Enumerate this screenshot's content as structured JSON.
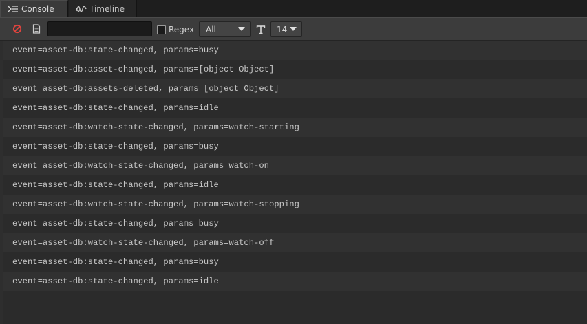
{
  "tabs": [
    {
      "label": "Console",
      "icon": "terminal-icon",
      "active": true
    },
    {
      "label": "Timeline",
      "icon": "timeline-icon",
      "active": false
    }
  ],
  "toolbar": {
    "filter_value": "",
    "regex_label": "Regex",
    "regex_checked": false,
    "level_select": "All",
    "font_size_select": "14",
    "clear_icon_color": "#e0443e"
  },
  "log_rows": [
    "event=asset-db:state-changed, params=busy",
    "event=asset-db:asset-changed, params=[object Object]",
    "event=asset-db:assets-deleted, params=[object Object]",
    "event=asset-db:state-changed, params=idle",
    "event=asset-db:watch-state-changed, params=watch-starting",
    "event=asset-db:state-changed, params=busy",
    "event=asset-db:watch-state-changed, params=watch-on",
    "event=asset-db:state-changed, params=idle",
    "event=asset-db:watch-state-changed, params=watch-stopping",
    "event=asset-db:state-changed, params=busy",
    "event=asset-db:watch-state-changed, params=watch-off",
    "event=asset-db:state-changed, params=busy",
    "event=asset-db:state-changed, params=idle"
  ]
}
